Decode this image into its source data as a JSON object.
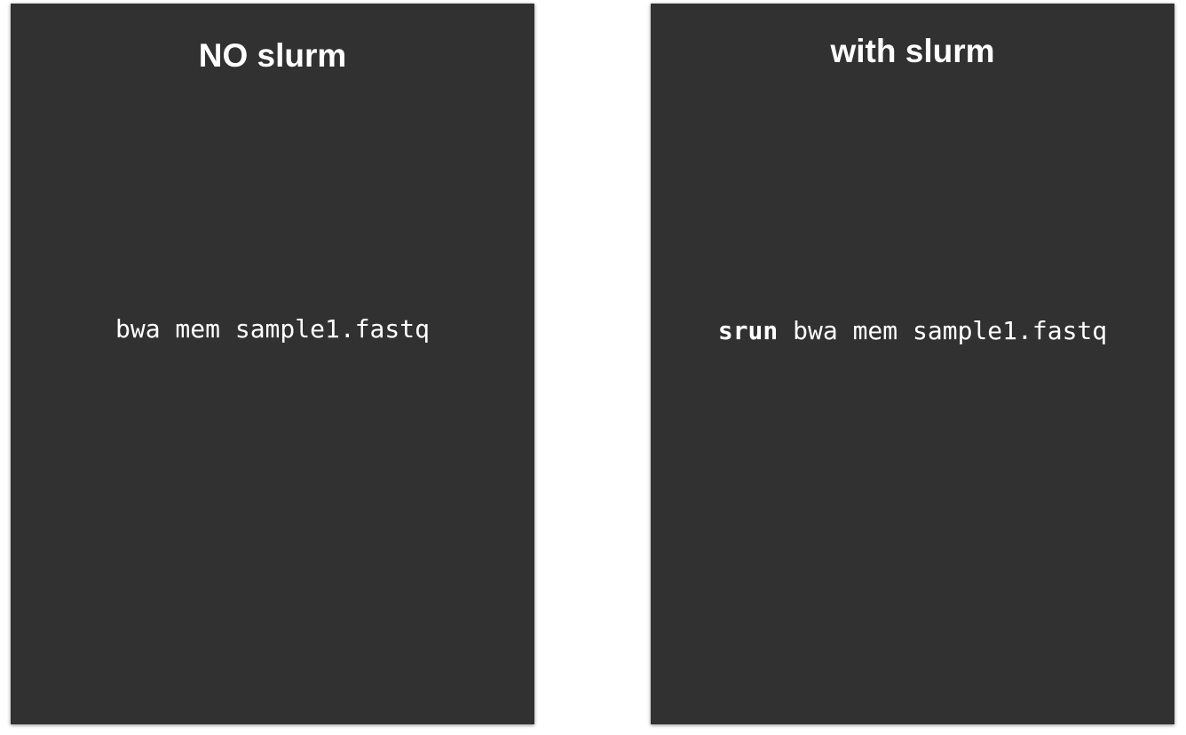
{
  "panels": [
    {
      "title": "NO slurm",
      "command": {
        "prefix": "",
        "text": "bwa mem sample1.fastq"
      }
    },
    {
      "title": "with slurm",
      "command": {
        "prefix": "srun",
        "text": "bwa mem sample1.fastq"
      }
    }
  ],
  "colors": {
    "panel_background": "#313131",
    "text": "#ffffff",
    "page_background": "#ffffff"
  }
}
